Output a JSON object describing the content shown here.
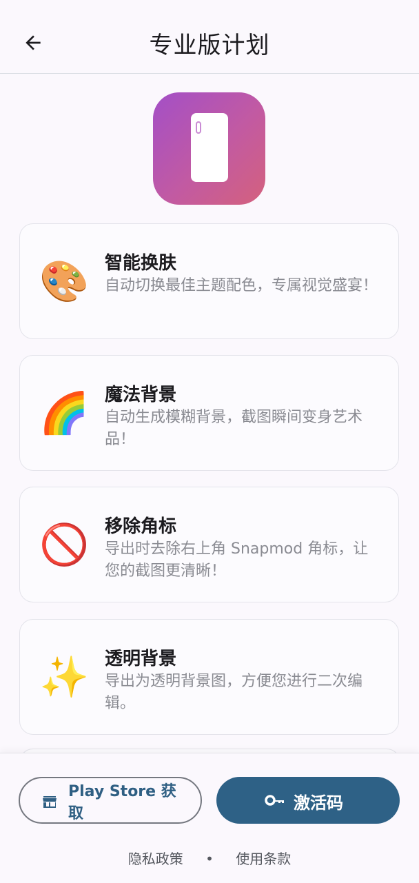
{
  "header": {
    "title": "专业版计划",
    "back_icon": "arrow-left-icon"
  },
  "features": [
    {
      "emoji": "🎨",
      "icon": "palette-icon",
      "title": "智能换肤",
      "desc": "自动切换最佳主题配色，专属视觉盛宴！"
    },
    {
      "emoji": "🌈",
      "icon": "rainbow-icon",
      "title": "魔法背景",
      "desc": "自动生成模糊背景，截图瞬间变身艺术品！"
    },
    {
      "emoji": "🚫",
      "icon": "prohibited-icon",
      "title": "移除角标",
      "desc": "导出时去除右上角 Snapmod 角标，让您的截图更清晰！"
    },
    {
      "emoji": "✨",
      "icon": "sparkles-icon",
      "title": "透明背景",
      "desc": "导出为透明背景图，方便您进行二次编辑。"
    }
  ],
  "actions": {
    "store_label": "Play Store 获取",
    "activation_label": "激活码"
  },
  "footer": {
    "privacy": "隐私政策",
    "separator": "•",
    "terms": "使用条款"
  },
  "colors": {
    "primary": "#2e6186",
    "background": "#fbf8fd",
    "logo_gradient_start": "#a34fc7",
    "logo_gradient_end": "#d4617d"
  }
}
